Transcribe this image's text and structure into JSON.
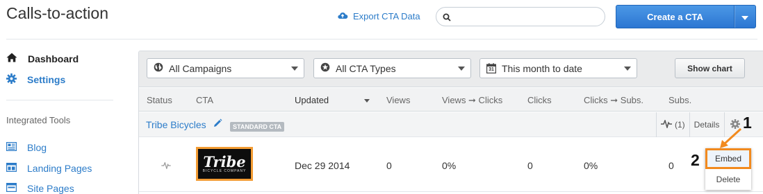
{
  "header": {
    "title": "Calls-to-action",
    "export_label": "Export CTA Data",
    "search_placeholder": "",
    "create_label": "Create a CTA"
  },
  "sidebar": {
    "dashboard": "Dashboard",
    "settings": "Settings",
    "integrated_heading": "Integrated Tools",
    "tools": [
      {
        "label": "Blog",
        "icon": "blog-icon"
      },
      {
        "label": "Landing Pages",
        "icon": "landing-pages-icon"
      },
      {
        "label": "Site Pages",
        "icon": "site-pages-icon"
      }
    ]
  },
  "filters": {
    "campaigns": "All Campaigns",
    "types": "All CTA Types",
    "date_range": "This month to date",
    "date_icon_day": "31",
    "show_chart": "Show chart"
  },
  "table": {
    "columns": [
      "Status",
      "CTA",
      "Updated",
      "Views",
      "Views ➞ Clicks",
      "Clicks",
      "Clicks ➞ Subs.",
      "Subs."
    ],
    "sorted_column": "Updated",
    "group": {
      "name": "Tribe Bicycles",
      "badge": "STANDARD CTA",
      "activity_count": "(1)",
      "details": "Details"
    },
    "row": {
      "thumb_brand": "Tribe",
      "thumb_sub": "BICYCLE COMPANY",
      "updated": "Dec 29 2014",
      "views": "0",
      "views_to_clicks": "0%",
      "clicks": "0",
      "clicks_to_subs": "0%",
      "subs": "0"
    }
  },
  "menu": {
    "embed": "Embed",
    "delete": "Delete"
  },
  "annotations": {
    "step1": "1",
    "step2": "2",
    "highlight_color": "#f28a1e"
  },
  "colors": {
    "accent": "#2c7cc9",
    "primary_button": "#2c76d2"
  }
}
